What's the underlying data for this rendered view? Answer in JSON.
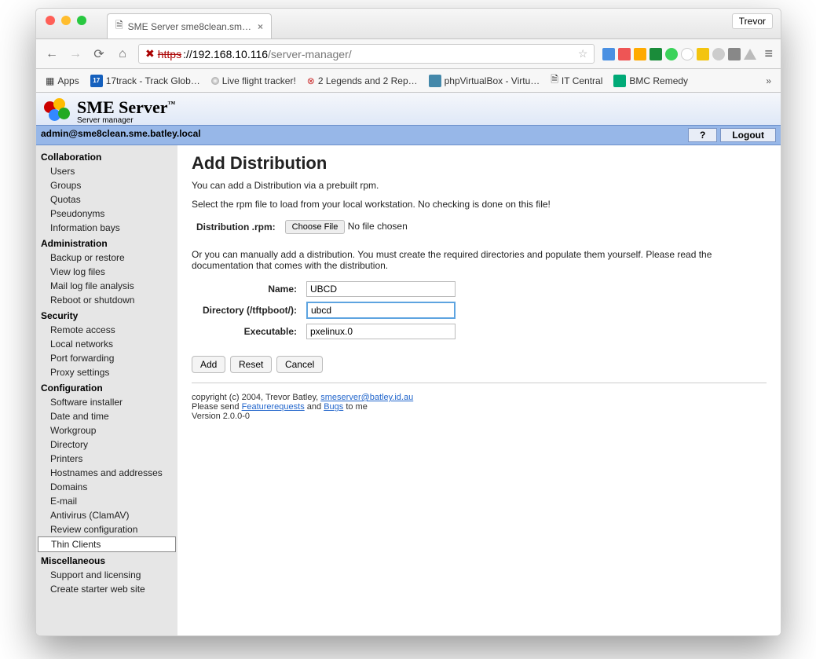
{
  "browser": {
    "user": "Trevor",
    "tab_title": "SME Server sme8clean.sm…",
    "url_scheme": "https",
    "url_host": "://192.168.10.116",
    "url_path": "/server-manager/",
    "bookmarks": [
      "Apps",
      "17track - Track Glob…",
      "Live flight tracker!",
      "2 Legends and 2 Rep…",
      "phpVirtualBox - Virtu…",
      "IT Central",
      "BMC Remedy"
    ]
  },
  "header": {
    "brand": "SME Server",
    "tm": "™",
    "sub": "Server manager",
    "admin_line": "admin@sme8clean.sme.batley.local",
    "help": "?",
    "logout": "Logout"
  },
  "sidebar": [
    {
      "cat": "Collaboration",
      "items": [
        "Users",
        "Groups",
        "Quotas",
        "Pseudonyms",
        "Information bays"
      ]
    },
    {
      "cat": "Administration",
      "items": [
        "Backup or restore",
        "View log files",
        "Mail log file analysis",
        "Reboot or shutdown"
      ]
    },
    {
      "cat": "Security",
      "items": [
        "Remote access",
        "Local networks",
        "Port forwarding",
        "Proxy settings"
      ]
    },
    {
      "cat": "Configuration",
      "items": [
        "Software installer",
        "Date and time",
        "Workgroup",
        "Directory",
        "Printers",
        "Hostnames and addresses",
        "Domains",
        "E-mail",
        "Antivirus (ClamAV)",
        "Review configuration",
        "Thin Clients"
      ]
    },
    {
      "cat": "Miscellaneous",
      "items": [
        "Support and licensing",
        "Create starter web site"
      ]
    }
  ],
  "selected_item": "Thin Clients",
  "main": {
    "title": "Add Distribution",
    "p1": "You can add a Distribution via a prebuilt rpm.",
    "p2": "Select the rpm file to load from your local workstation. No checking is done on this file!",
    "rpm_label": "Distribution .rpm:",
    "choose": "Choose File",
    "nofile": "No file chosen",
    "p3": "Or you can manually add a distribution. You must create the required directories and populate them yourself. Please read the documentation that comes with the distribution.",
    "name_label": "Name:",
    "name_value": "UBCD",
    "dir_label": "Directory (/tftpboot/):",
    "dir_value": "ubcd",
    "exec_label": "Executable:",
    "exec_value": "pxelinux.0",
    "add": "Add",
    "reset": "Reset",
    "cancel": "Cancel",
    "copyright": "copyright (c) 2004, Trevor Batley, ",
    "email": "smeserver@batley.id.au",
    "please": "Please send ",
    "fr": "Featurerequests",
    "and": " and ",
    "bugs": "Bugs",
    "tome": " to me",
    "version": "Version 2.0.0-0"
  }
}
